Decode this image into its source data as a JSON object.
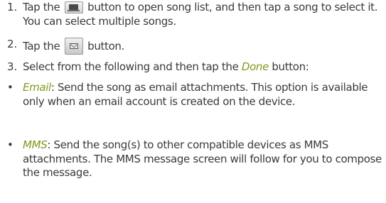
{
  "steps": [
    {
      "number": "1.",
      "text_before_icon": "Tap the",
      "icon": "song-list-icon",
      "text_after_icon": "button to open song list, and then tap a song to select it. You can select multiple songs."
    },
    {
      "number": "2.",
      "text_before_icon": "Tap the",
      "icon": "send-icon",
      "text_after_icon": "button."
    },
    {
      "number": "3.",
      "text_before_link": "Select from the following and then tap the",
      "link": "Done",
      "text_after_link": "button:"
    }
  ],
  "options": [
    {
      "bullet": "•",
      "label": "Email",
      "description": ": Send the song as email attachments. This option is available only when an email account is created on the device."
    },
    {
      "bullet": "•",
      "label": "MMS",
      "description": ": Send the song(s) to other compatible devices as MMS attachments. The MMS message screen will follow for you to compose the message."
    }
  ],
  "colors": {
    "text": "#3a3a3a",
    "link": "#7d9a1c"
  }
}
